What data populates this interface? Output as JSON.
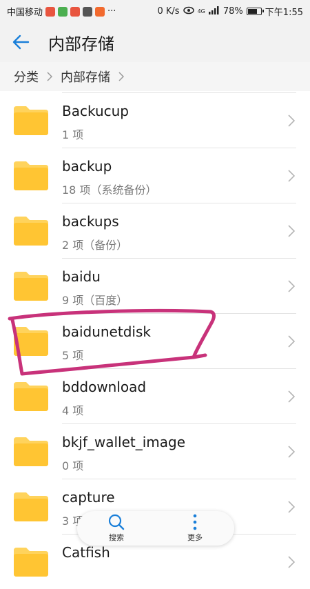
{
  "status_bar": {
    "carrier": "中国移动",
    "more": "···",
    "speed": "0 K/s",
    "network": "4G",
    "battery": "78%",
    "battery_level": 0.78,
    "time": "下午1:55"
  },
  "app_bar": {
    "title": "内部存储"
  },
  "breadcrumb": {
    "items": [
      "分类",
      "内部存储"
    ]
  },
  "folders": [
    {
      "name": "Backucup",
      "meta": "1 项"
    },
    {
      "name": "backup",
      "meta": "18 项（系统备份）"
    },
    {
      "name": "backups",
      "meta": "2 项（备份）"
    },
    {
      "name": "baidu",
      "meta": "9 项（百度）"
    },
    {
      "name": "baidunetdisk",
      "meta": "5 项"
    },
    {
      "name": "bddownload",
      "meta": "4 项"
    },
    {
      "name": "bkjf_wallet_image",
      "meta": "0 项"
    },
    {
      "name": "capture",
      "meta": "3 项"
    },
    {
      "name": "Catfish",
      "meta": ""
    }
  ],
  "bottom_bar": {
    "search_label": "搜索",
    "more_label": "更多"
  },
  "colors": {
    "accent": "#1a7fd9",
    "folder": "#ffc533",
    "annotation": "#c8327a"
  }
}
